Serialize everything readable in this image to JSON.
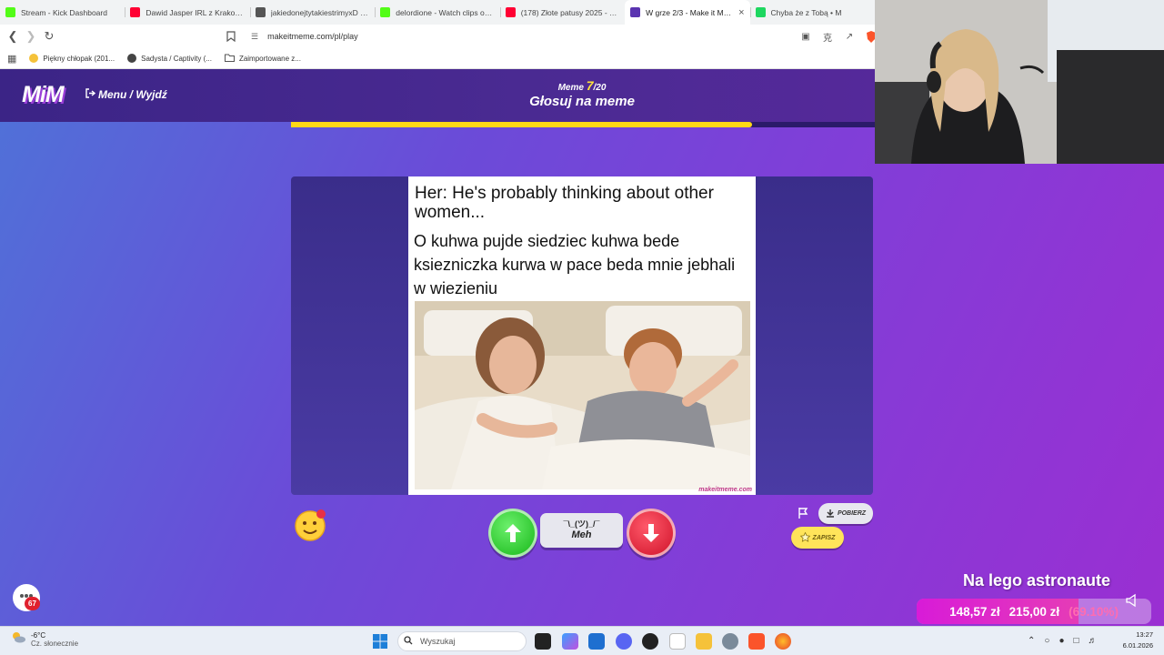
{
  "browser": {
    "tabs": [
      {
        "label": "Stream - Kick Dashboard",
        "icon": "kick-icon",
        "color": "#53fc18",
        "active": false
      },
      {
        "label": "Dawid Jasper IRL z Krakowa - S",
        "icon": "youtube-icon",
        "color": "#ff0033",
        "active": false
      },
      {
        "label": "jakiedonejtytakiestrimyxD - Wi",
        "icon": "spiral-icon",
        "color": "#555555",
        "active": false
      },
      {
        "label": "delordione - Watch clips on Ki",
        "icon": "kick-icon",
        "color": "#53fc18",
        "active": false
      },
      {
        "label": "(178) Złote patusy 2025 - YouT",
        "icon": "youtube-icon",
        "color": "#ff0033",
        "active": false
      },
      {
        "label": "W grze 2/3 - Make it Mem",
        "icon": "mim-icon",
        "color": "#5a34b0",
        "active": true
      },
      {
        "label": "Chyba że z Tobą • M",
        "icon": "spotify-icon",
        "color": "#1ed760",
        "active": false
      }
    ],
    "url": "makeitmeme.com/pl/play",
    "bookmarks": [
      {
        "label": "Piękny chłopak (201...",
        "icon": "emoji-icon"
      },
      {
        "label": "Sadysta / Captivity (...",
        "icon": "globe-icon"
      },
      {
        "label": "Zaimportowane z...",
        "icon": "folder-icon"
      }
    ]
  },
  "app": {
    "logo": "MiM",
    "menu_exit": "Menu / Wyjdź",
    "meme_label": "Meme",
    "meme_current": "7",
    "meme_total": "/20",
    "phase_title": "Głosuj na meme",
    "progress": 0.79,
    "meme": {
      "top_text": "Her: He's probably thinking about other women...",
      "caption": "O kuhwa pujde siedziec kuhwa bede ksiezniczka kurwa w pace beda mnie jebhali w wiezieniu",
      "watermark": "makeitmeme.com"
    },
    "buttons": {
      "meh_shrug": "¯\\_(ツ)_/¯",
      "meh_label": "Meh",
      "download": "POBIERZ",
      "save": "ZAPISZ"
    },
    "chat_badge": "67"
  },
  "donation_goal": {
    "title": "Na lego astronaute",
    "current": "148,57 zł",
    "target": "215,00 zł",
    "percent": "(69.10%)",
    "fraction": 0.691
  },
  "taskbar": {
    "weather_temp": "-6°C",
    "weather_desc": "Cz. słonecznie",
    "search_placeholder": "Wyszukaj",
    "time": "13:27",
    "date": "6.01.2026"
  }
}
